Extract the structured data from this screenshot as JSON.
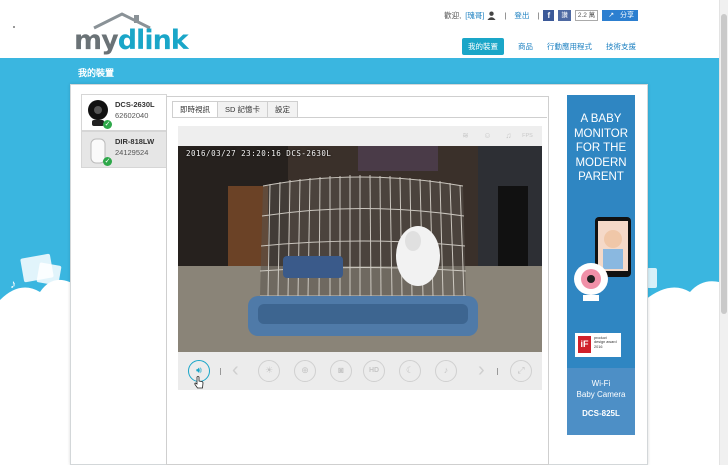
{
  "header": {
    "logo_my": "my",
    "logo_dlink": "dlink",
    "greeting": "歡迎,",
    "username": "[瑰哥]",
    "separator": "|",
    "logout": "登出",
    "fb_like": "讚",
    "fb_count": "2.2 萬",
    "share": "分享"
  },
  "nav": {
    "items": [
      {
        "label": "我的裝置",
        "active": true
      },
      {
        "label": "商品"
      },
      {
        "label": "行動應用程式"
      },
      {
        "label": "技術支援"
      }
    ]
  },
  "page": {
    "title": "我的裝置"
  },
  "devices": [
    {
      "name": "DCS-2630L",
      "id": "62602040",
      "selected": true
    },
    {
      "name": "DIR-818LW",
      "id": "24129524",
      "selected": false
    }
  ],
  "tabs": [
    {
      "label": "即時視訊",
      "active": true
    },
    {
      "label": "SD 記憶卡"
    },
    {
      "label": "設定"
    }
  ],
  "video": {
    "osd": "2016/03/27  23:20:16  DCS-2630L"
  },
  "status_icons": [
    "motion-icon",
    "person-icon",
    "sound-icon",
    "fps-icon"
  ],
  "status_fps": "FPS",
  "controls": {
    "hd_label": "HD"
  },
  "ad": {
    "headline": [
      "A BABY",
      "MONITOR",
      "FOR THE",
      "MODERN",
      "PARENT"
    ],
    "product_line1": "Wi-Fi",
    "product_line2": "Baby Camera",
    "model": "DCS-825L",
    "award_text": [
      "product",
      "design award",
      "2016"
    ]
  },
  "colors": {
    "brand_blue": "#1aa6c8",
    "band": "#3ab6e0",
    "ad_bg": "#2f86c2",
    "online_green": "#2ea84a"
  }
}
